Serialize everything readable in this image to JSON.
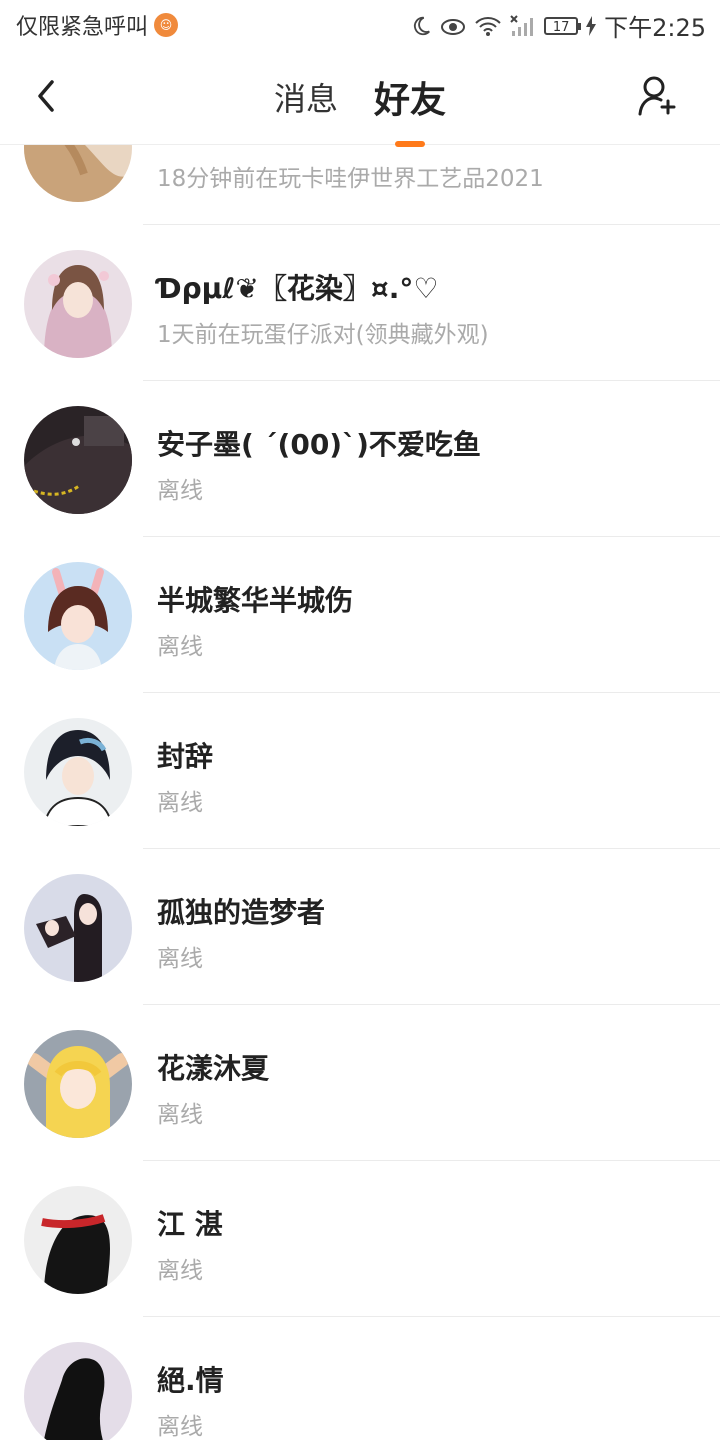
{
  "status_bar": {
    "carrier": "仅限紧急呼叫",
    "battery": "17",
    "time": "下午2:25"
  },
  "header": {
    "tabs": [
      {
        "label": "消息",
        "active": false
      },
      {
        "label": "好友",
        "active": true
      }
    ],
    "accent_color": "#ff7a1a"
  },
  "friends": [
    {
      "name": "",
      "status": "18分钟前在玩卡哇伊世界工艺品2021"
    },
    {
      "name": "Ɗρμℓ❦〖花染〗¤.°♡",
      "status": "1天前在玩蛋仔派对(领典藏外观)"
    },
    {
      "name": "安子墨( ´(00)`)不爱吃鱼",
      "status": "离线"
    },
    {
      "name": "半城繁华半城伤",
      "status": "离线"
    },
    {
      "name": "封辞",
      "status": "离线"
    },
    {
      "name": "孤独的造梦者",
      "status": "离线"
    },
    {
      "name": "花漾沐夏",
      "status": "离线"
    },
    {
      "name": "江 湛",
      "status": "离线"
    },
    {
      "name": "絕.情",
      "status": "离线"
    }
  ]
}
